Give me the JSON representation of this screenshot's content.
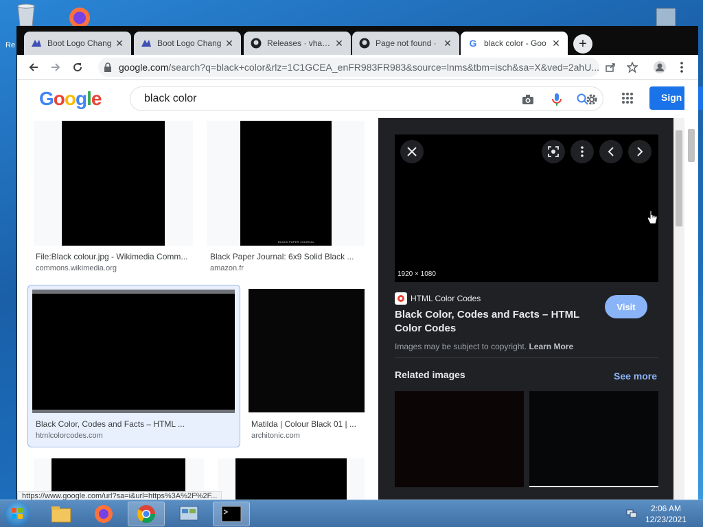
{
  "desktop": {
    "icon_labels": [
      "Re"
    ]
  },
  "tabs": [
    {
      "title": "Boot Logo Chang",
      "icon": "boot-logo-icon",
      "active": false
    },
    {
      "title": "Boot Logo Chang",
      "icon": "boot-logo-icon",
      "active": false
    },
    {
      "title": "Releases · vhanla",
      "icon": "github-icon",
      "active": false
    },
    {
      "title": "Page not found ·",
      "icon": "github-icon",
      "active": false
    },
    {
      "title": "black color - Goo",
      "icon": "google-icon",
      "active": true
    }
  ],
  "new_tab_label": "+",
  "address_bar": {
    "host": "google.com",
    "rest": "/search?q=black+color&rlz=1C1GCEA_enFR983FR983&source=lnms&tbm=isch&sa=X&ved=2ahU..."
  },
  "google": {
    "logo_letters": [
      "G",
      "o",
      "o",
      "g",
      "l",
      "e"
    ],
    "logo_colors": [
      "#4285f4",
      "#ea4335",
      "#fbbc05",
      "#4285f4",
      "#34a853",
      "#ea4335"
    ],
    "query": "black color",
    "signin_label": "Sign i"
  },
  "results": [
    {
      "title": "File:Black colour.jpg - Wikimedia Comm...",
      "source": "commons.wikimedia.org"
    },
    {
      "title": "Black Paper Journal: 6x9 Solid Black ...",
      "source": "amazon.fr",
      "caption": "BLACK PAPER JOURNAL"
    },
    {
      "title": "Black Color, Codes and Facts – HTML ...",
      "source": "htmlcolorcodes.com",
      "selected": true
    },
    {
      "title": "Matilda | Colour Black 01 | ...",
      "source": "architonic.com"
    }
  ],
  "preview": {
    "dimensions": "1920 × 1080",
    "site_name": "HTML Color Codes",
    "title": "Black Color, Codes and Facts – HTML Color Codes",
    "visit_label": "Visit",
    "copyright_text": "Images may be subject to copyright.",
    "learn_more": "Learn More",
    "related_heading": "Related images",
    "see_more": "See more"
  },
  "status_url": "https://www.google.com/url?sa=i&url=https%3A%2F%2F...",
  "taskbar": {
    "time": "2:06 AM",
    "date": "12/23/2021"
  }
}
